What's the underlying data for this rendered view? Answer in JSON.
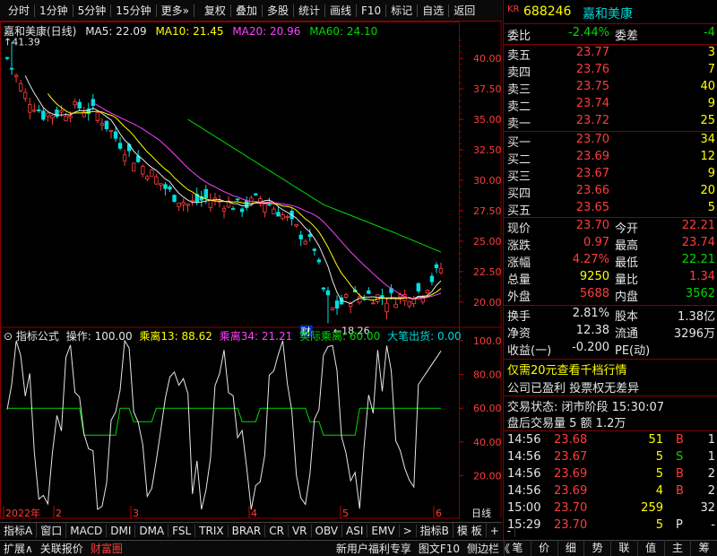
{
  "toolbar": [
    "分时",
    "1分钟",
    "5分钟",
    "15分钟",
    "更多»",
    "复权",
    "叠加",
    "多股",
    "统计",
    "画线",
    "F10",
    "标记",
    "自选",
    "返回"
  ],
  "main": {
    "stock_label": "嘉和美康(日线)",
    "ma5": "MA5: 22.09",
    "ma10": "MA10: 21.45",
    "ma20": "MA20: 20.96",
    "ma60": "MA60: 24.10",
    "high_mark": "41.39",
    "low_mark": "18.26",
    "cai_badge": "财",
    "y_ticks": [
      "40.00",
      "37.50",
      "35.00",
      "32.50",
      "30.00",
      "27.50",
      "25.00",
      "22.50",
      "20.00"
    ],
    "x_labels": [
      "2022年",
      "2",
      "3",
      "4",
      "5",
      "6"
    ],
    "x_right": "日线"
  },
  "indicator": {
    "name": "指标公式",
    "op": "操作: 100.00",
    "g13": "乘离13: 88.62",
    "g34": "乘离34: 21.21",
    "real": "实际乘离: 60.00",
    "big": "大笔出货: 0.00",
    "y_ticks": [
      "100.0",
      "80.00",
      "60.00",
      "40.00",
      "20.00"
    ]
  },
  "bottom_tabs": [
    "指标A",
    "窗口",
    "MACD",
    "DMI",
    "DMA",
    "FSL",
    "TRIX",
    "BRAR",
    "CR",
    "VR",
    "OBV",
    "ASI",
    "EMV",
    ">",
    "指标B",
    "模 板",
    "+",
    "-"
  ],
  "bottom_bar": [
    "扩展∧",
    "关联报价",
    "财富圈",
    "新用户福利专享",
    "图文F10",
    "侧边栏《"
  ],
  "right_tabs": [
    "笔",
    "价",
    "细",
    "势",
    "联",
    "值",
    "主",
    "筹"
  ],
  "quote": {
    "kr": "KR",
    "code": "688246",
    "name": "嘉和美康",
    "wei_bi_label": "委比",
    "wei_bi": "-2.44%",
    "wei_cha_label": "委差",
    "wei_cha": "-4",
    "asks": [
      {
        "label": "卖五",
        "price": "23.77",
        "vol": "3"
      },
      {
        "label": "卖四",
        "price": "23.76",
        "vol": "7"
      },
      {
        "label": "卖三",
        "price": "23.75",
        "vol": "40"
      },
      {
        "label": "卖二",
        "price": "23.74",
        "vol": "9"
      },
      {
        "label": "卖一",
        "price": "23.72",
        "vol": "25"
      }
    ],
    "bids": [
      {
        "label": "买一",
        "price": "23.70",
        "vol": "34"
      },
      {
        "label": "买二",
        "price": "23.69",
        "vol": "12"
      },
      {
        "label": "买三",
        "price": "23.67",
        "vol": "9"
      },
      {
        "label": "买四",
        "price": "23.66",
        "vol": "20"
      },
      {
        "label": "买五",
        "price": "23.65",
        "vol": "5"
      }
    ],
    "stats": [
      [
        "现价",
        "23.70",
        "今开",
        "22.21"
      ],
      [
        "涨跌",
        "0.97",
        "最高",
        "23.74"
      ],
      [
        "涨幅",
        "4.27%",
        "最低",
        "22.21"
      ],
      [
        "总量",
        "9250",
        "量比",
        "1.34"
      ],
      [
        "外盘",
        "5688",
        "内盘",
        "3562"
      ]
    ],
    "stats2": [
      [
        "换手",
        "2.81%",
        "股本",
        "1.38亿"
      ],
      [
        "净资",
        "12.38",
        "流通",
        "3296万"
      ],
      [
        "收益(一)",
        "-0.200",
        "PE(动)",
        ""
      ]
    ],
    "promo": "仅需20元查看千档行情",
    "info": "公司已盈利 投票权无差异",
    "status": "交易状态: 闭市阶段 15:30:07",
    "after": "盘后交易量 5 额 1.2万",
    "ticks": [
      [
        "14:56",
        "23.68",
        "51",
        "B",
        "1"
      ],
      [
        "14:56",
        "23.67",
        "5",
        "S",
        "1"
      ],
      [
        "14:56",
        "23.69",
        "5",
        "B",
        "2"
      ],
      [
        "14:56",
        "23.69",
        "4",
        "B",
        "2"
      ],
      [
        "15:00",
        "23.70",
        "259",
        "",
        "32"
      ],
      [
        "15:29",
        "23.70",
        "5",
        "P",
        "-"
      ]
    ]
  },
  "chart_data": {
    "type": "candlestick",
    "price_range": [
      18.26,
      41.39
    ],
    "indicator_range": [
      0,
      100
    ]
  }
}
